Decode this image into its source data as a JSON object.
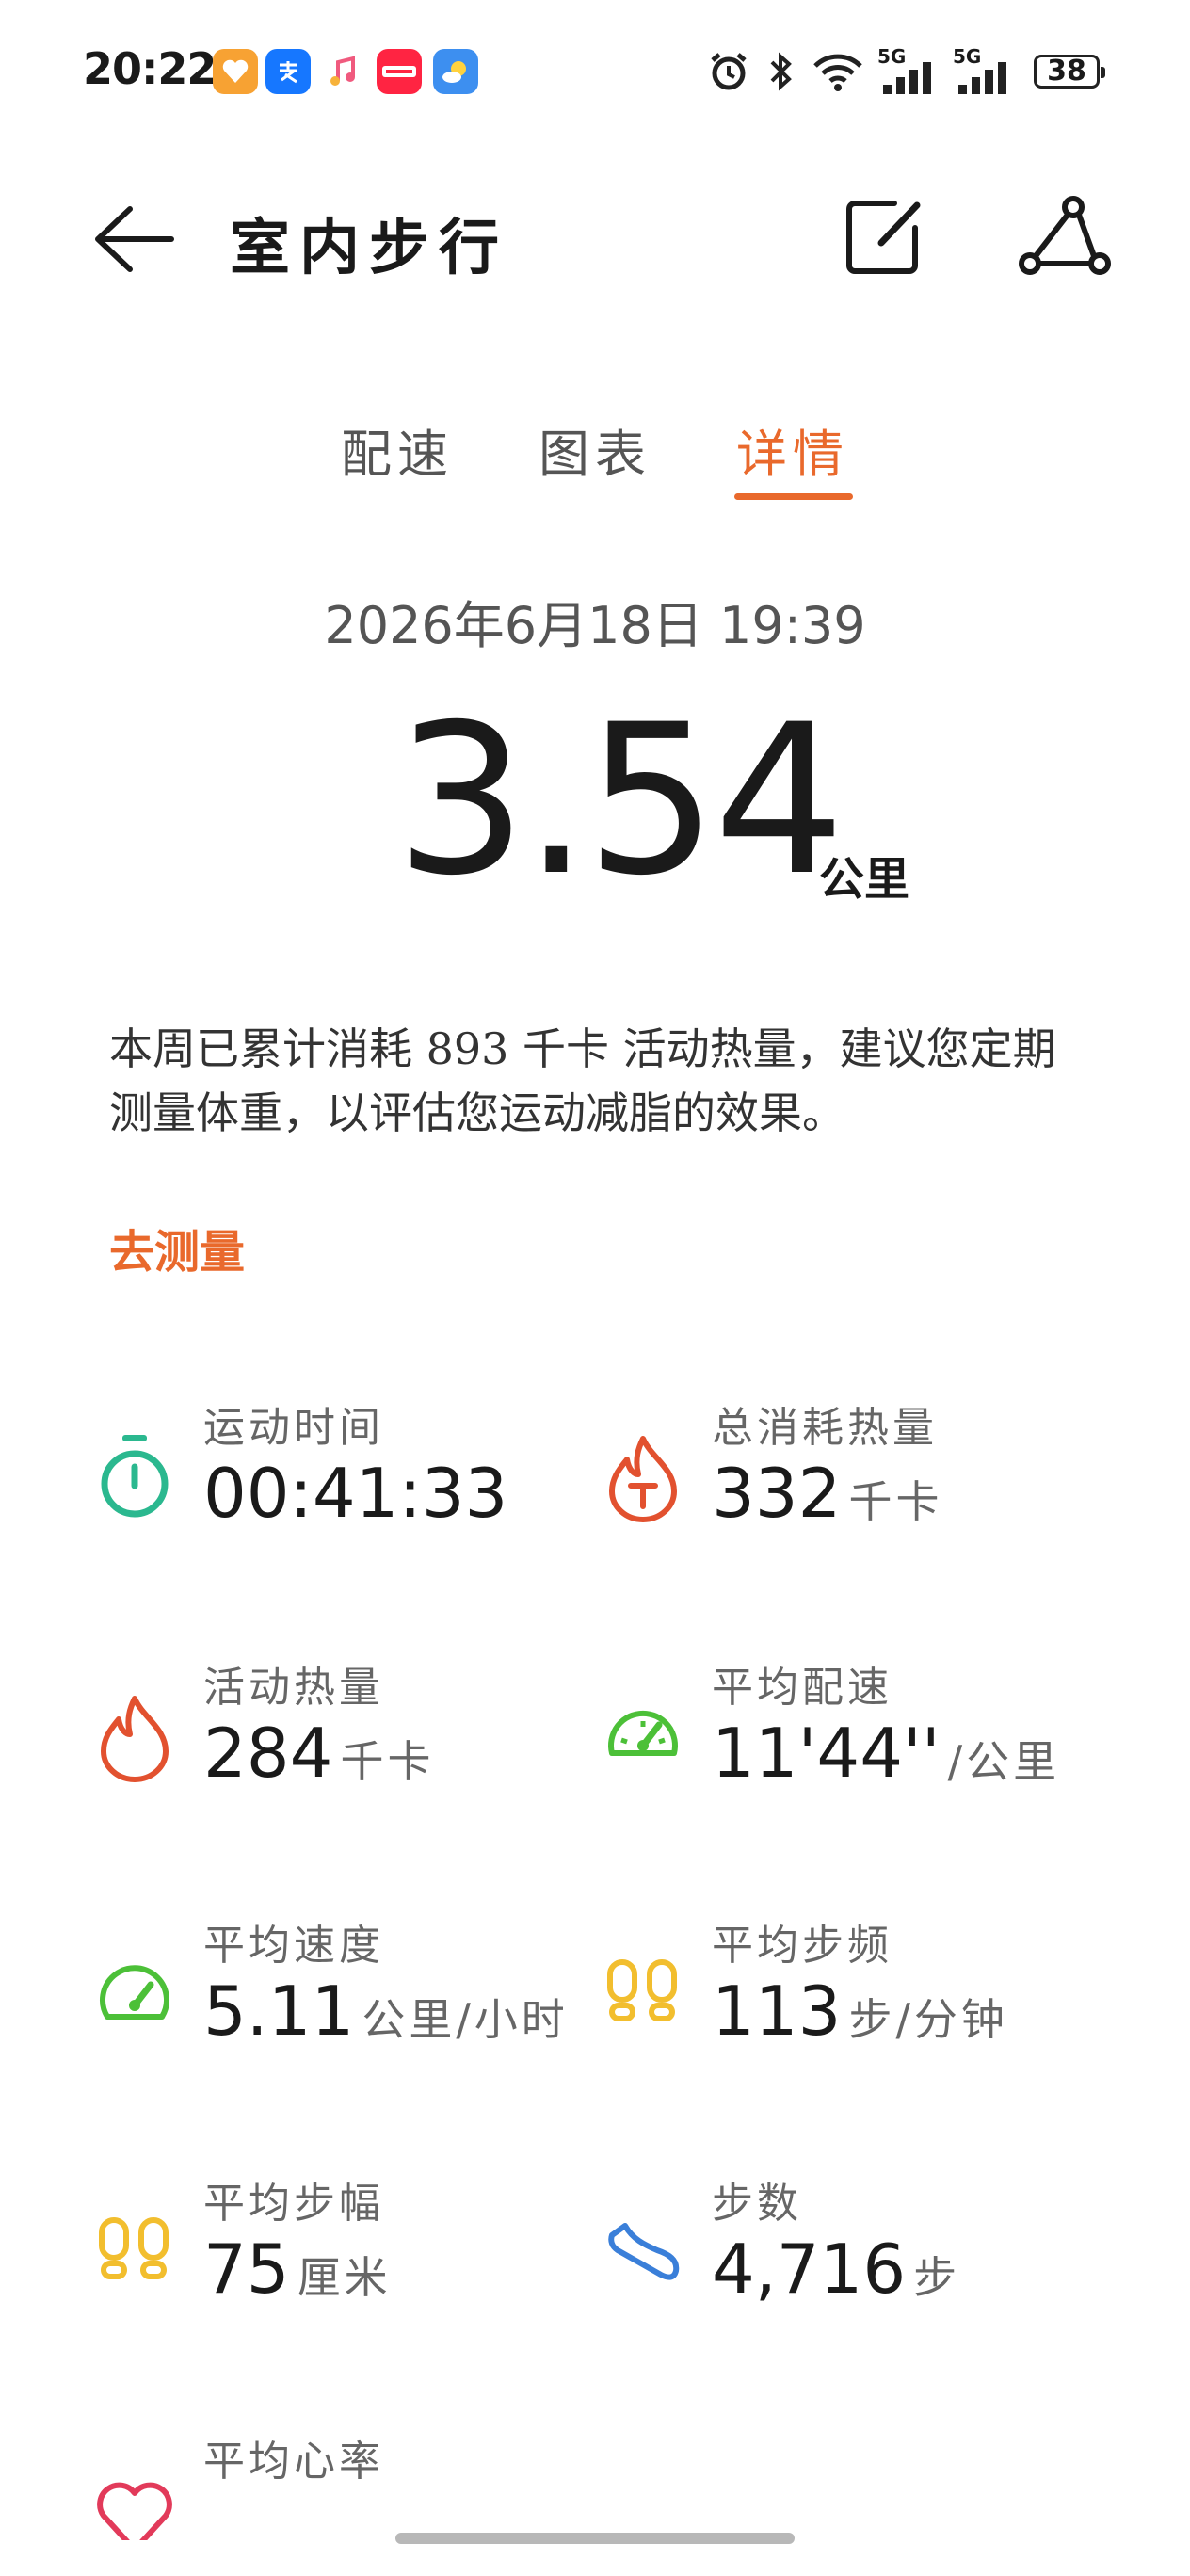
{
  "status_bar": {
    "time": "20:22",
    "battery": "38",
    "network1": "5G",
    "network2": "5G"
  },
  "header": {
    "title": "室内步行"
  },
  "tabs": [
    {
      "label": "配速",
      "active": false
    },
    {
      "label": "图表",
      "active": false
    },
    {
      "label": "详情",
      "active": true
    }
  ],
  "summary": {
    "datetime": "2026年6月18日  19:39",
    "distance": "3.54",
    "distance_unit": "公里",
    "notice": "本周已累计消耗 893 千卡 活动热量，建议您定期测量体重，以评估您运动减脂的效果。",
    "measure_link": "去测量"
  },
  "metrics": [
    {
      "label": "运动时间",
      "value": "00:41:33",
      "unit": "",
      "icon": "stopwatch-icon",
      "color": "#2bb88f"
    },
    {
      "label": "总消耗热量",
      "value": "332",
      "unit": "千卡",
      "icon": "flame-total-icon",
      "color": "#e2512f"
    },
    {
      "label": "活动热量",
      "value": "284",
      "unit": "千卡",
      "icon": "flame-icon",
      "color": "#e2512f"
    },
    {
      "label": "平均配速",
      "value": "11'44''",
      "unit": "/公里",
      "icon": "gauge-icon",
      "color": "#4cc038"
    },
    {
      "label": "平均速度",
      "value": "5.11",
      "unit": "公里/小时",
      "icon": "speedometer-icon",
      "color": "#4cc038"
    },
    {
      "label": "平均步频",
      "value": "113",
      "unit": "步/分钟",
      "icon": "footprints-icon",
      "color": "#f2be2e"
    },
    {
      "label": "平均步幅",
      "value": "75",
      "unit": "厘米",
      "icon": "footprints-icon",
      "color": "#f2be2e"
    },
    {
      "label": "步数",
      "value": "4,716",
      "unit": "步",
      "icon": "shoe-icon",
      "color": "#3a7fd9"
    },
    {
      "label": "平均心率",
      "value": "",
      "unit": "",
      "icon": "heart-icon",
      "color": "#e23a5a"
    }
  ],
  "colors": {
    "accent": "#e9692c"
  }
}
